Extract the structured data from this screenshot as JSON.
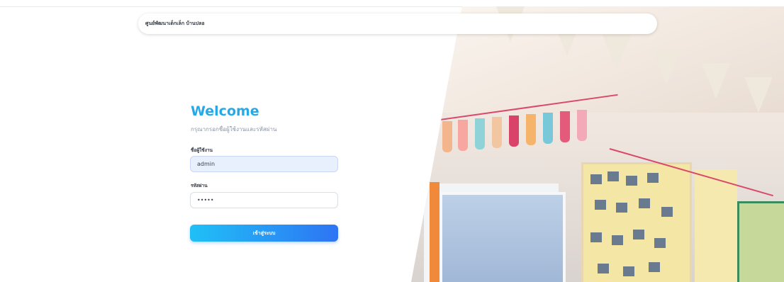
{
  "header": {
    "title": "ศูนย์พัฒนาเด็กเล็ก บ้านปลอ"
  },
  "login": {
    "welcome": "Welcome",
    "subtitle": "กรุณากรอกชื่อผู้ใช้งานและรหัสผ่าน",
    "username_label": "ชื่อผู้ใช้งาน",
    "username_value": "admin",
    "password_label": "รหัสผ่าน",
    "password_value": "•••••",
    "submit_label": "เข้าสู่ระบบ"
  },
  "colors": {
    "accent": "#29a8e8",
    "button_start": "#20c0f6",
    "button_end": "#2e74f4",
    "input_filled_bg": "#e8f0fe"
  },
  "decor": {
    "image": "classroom-photo"
  }
}
